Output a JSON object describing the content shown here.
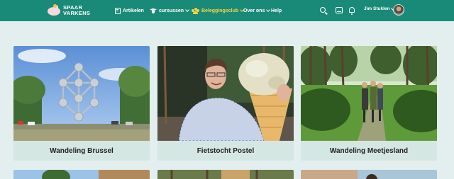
{
  "brand": {
    "line1": "SPAAR",
    "line2": "VARKENS"
  },
  "nav": [
    {
      "label": "Artikelen",
      "icon": "book-icon",
      "dropdown": false,
      "active": false
    },
    {
      "label": "cursussen",
      "icon": "graduation-cap-icon",
      "dropdown": true,
      "active": false
    },
    {
      "label": "Beleggingsclub",
      "icon": "users-icon",
      "dropdown": true,
      "active": true
    },
    {
      "label": "Over ons",
      "icon": null,
      "dropdown": true,
      "active": false
    },
    {
      "label": "Help",
      "icon": null,
      "dropdown": false,
      "active": false
    }
  ],
  "header_icons": [
    "search-icon",
    "inbox-icon",
    "bell-icon"
  ],
  "user": {
    "name": "Jim Stuklen"
  },
  "colors": {
    "header_bg": "#1a8a78",
    "page_bg": "#e3efee",
    "card_bg": "#d5e7e3",
    "active_nav": "#f5d342"
  },
  "cards": [
    {
      "title": "Wandeling Brussel"
    },
    {
      "title": "Fietstocht Postel"
    },
    {
      "title": "Wandeling Meetjesland"
    }
  ]
}
